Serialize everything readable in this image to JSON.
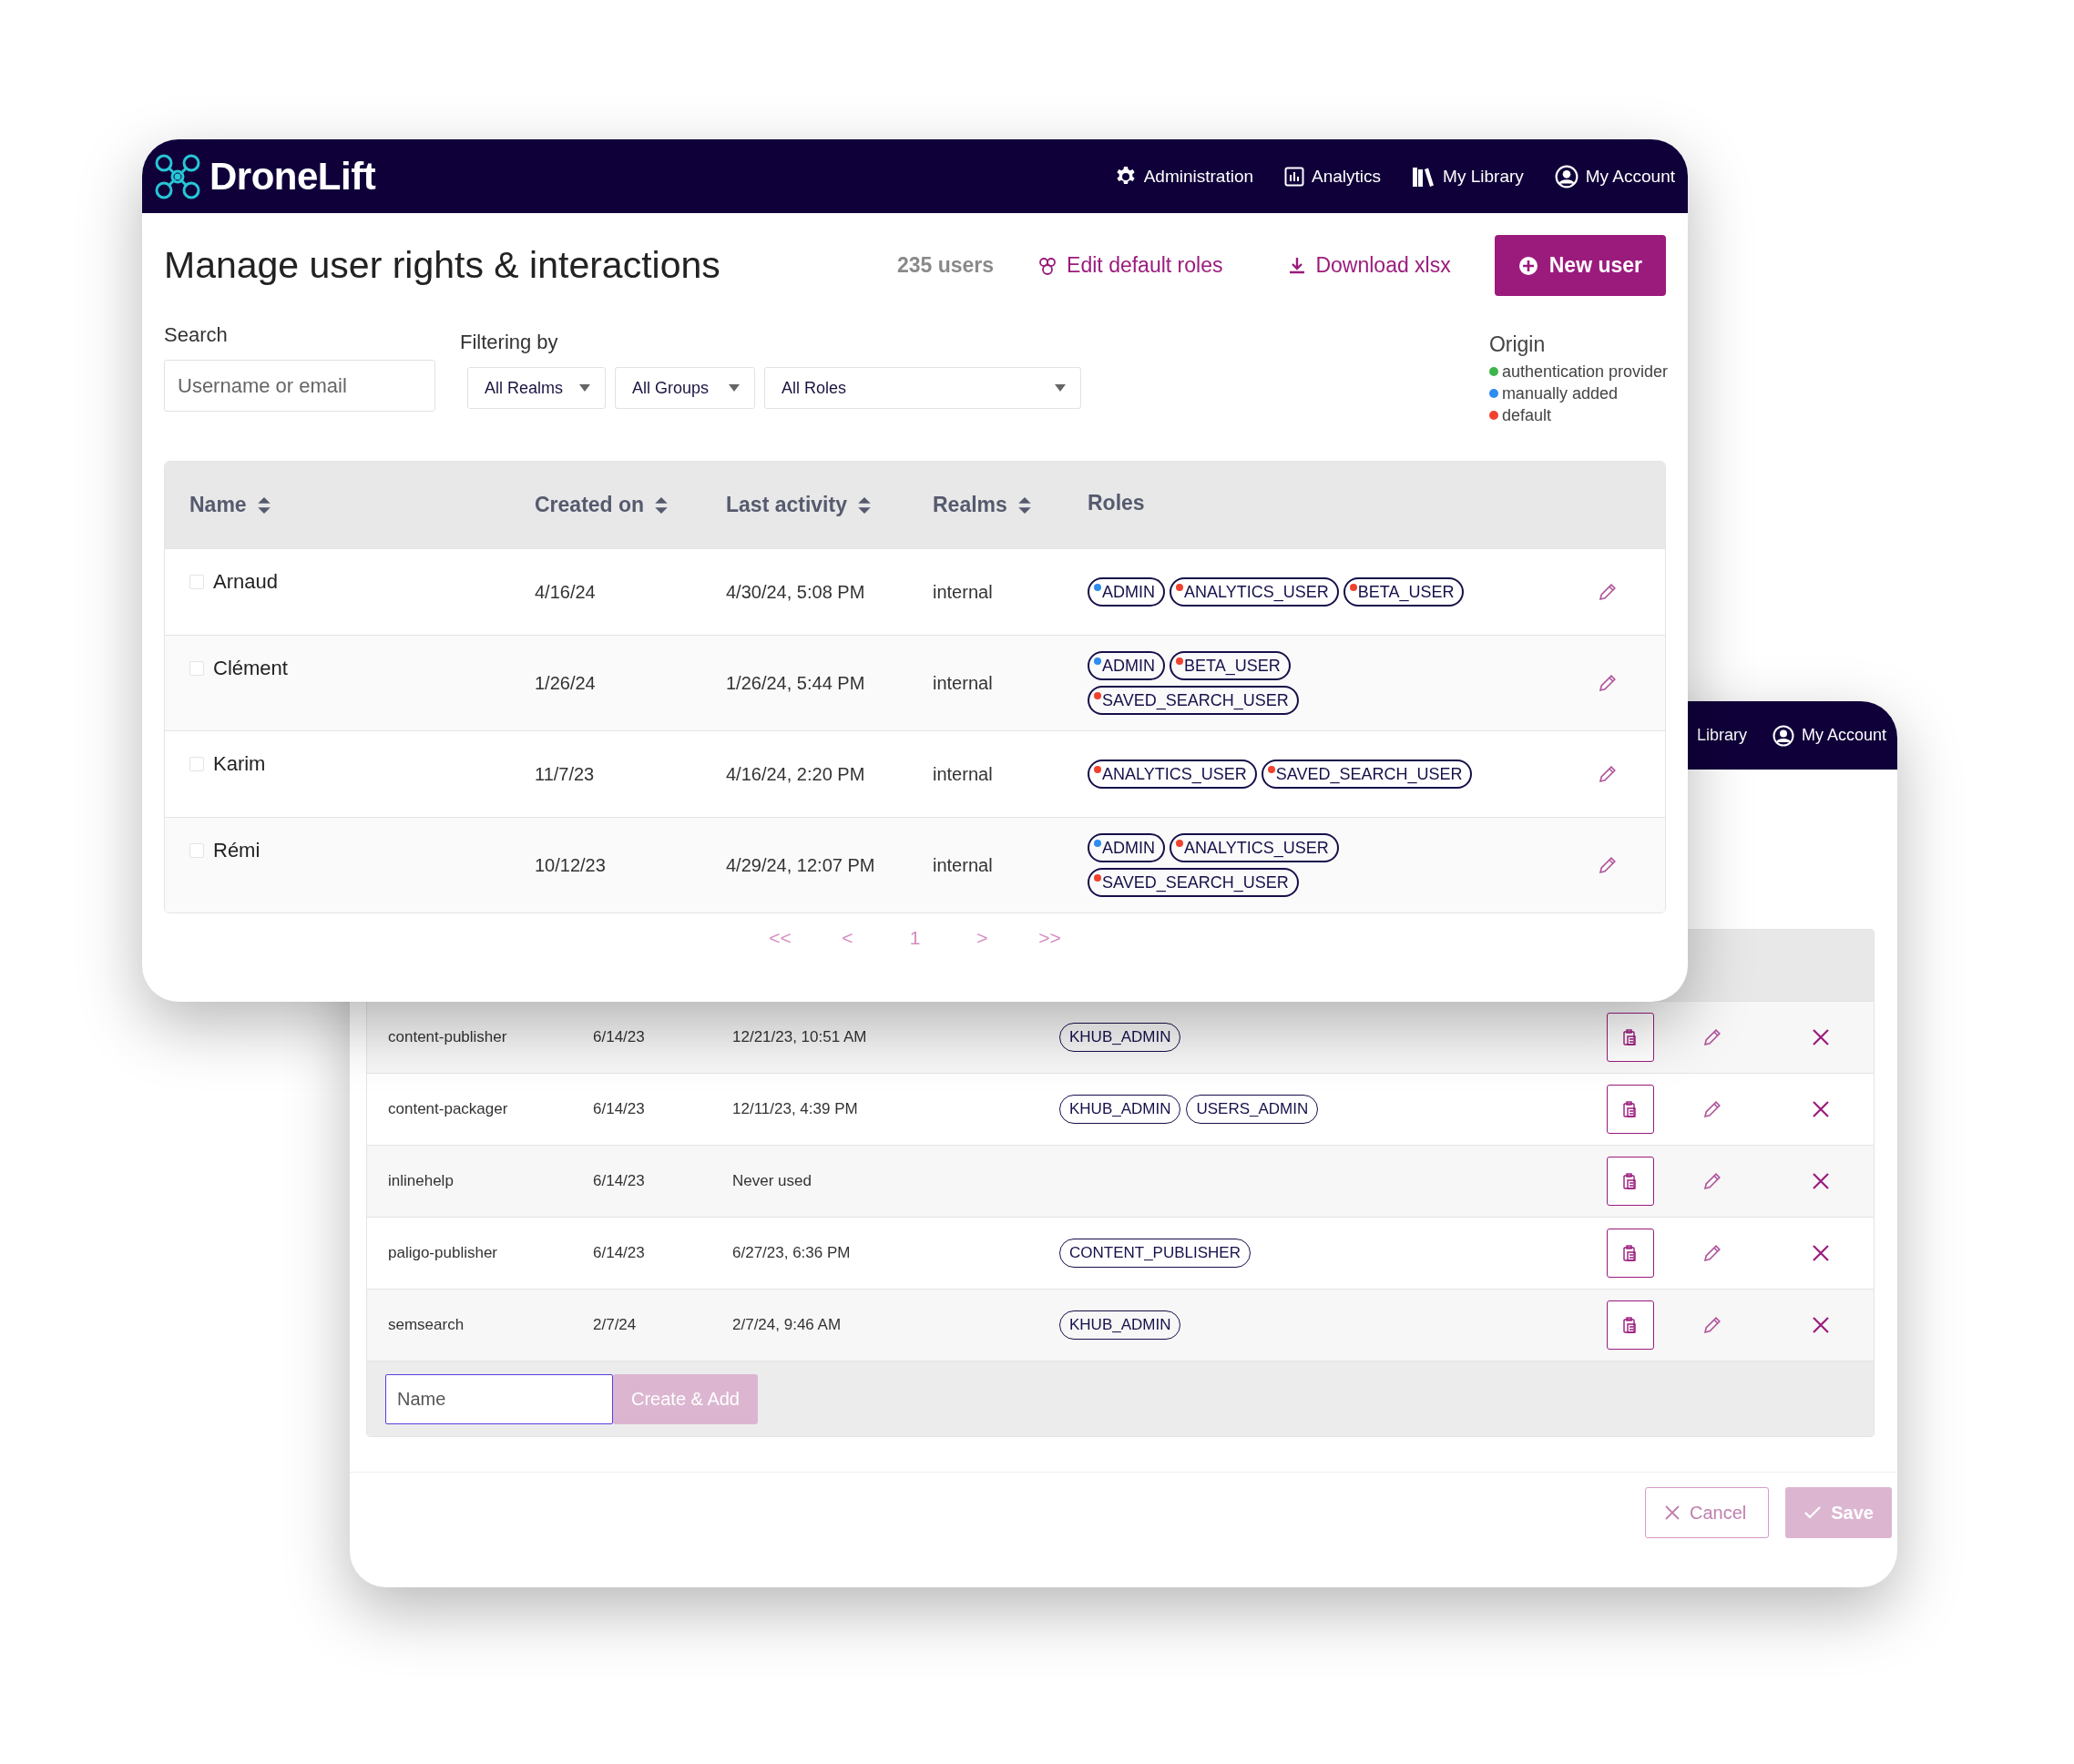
{
  "main_window": {
    "brand": "DroneLift",
    "nav": [
      "Administration",
      "Analytics",
      "My Library",
      "My Account"
    ],
    "title": "Manage user rights & interactions",
    "user_count": "235 users",
    "edit_roles": "Edit default roles",
    "download": "Download xlsx",
    "new_user": "New user",
    "search": {
      "label": "Search",
      "placeholder": "Username or email"
    },
    "filters": {
      "label": "Filtering by",
      "selects": [
        "All Realms",
        "All Groups",
        "All Roles"
      ]
    },
    "origin": {
      "title": "Origin",
      "items": [
        {
          "label": "authentication provider",
          "color": "#3cb54a"
        },
        {
          "label": "manually added",
          "color": "#2f8cf0"
        },
        {
          "label": "default",
          "color": "#f0422e"
        }
      ]
    },
    "table": {
      "columns": [
        {
          "label": "Name",
          "sortable": true
        },
        {
          "label": "Created on",
          "sortable": true
        },
        {
          "label": "Last activity",
          "sortable": true
        },
        {
          "label": "Realms",
          "sortable": true
        },
        {
          "label": "Roles",
          "sortable": false
        }
      ],
      "rows": [
        {
          "checked": false,
          "name": "Arnaud",
          "created": "4/16/24",
          "last_activity": "4/30/24, 5:08 PM",
          "realm": "internal",
          "roles": [
            {
              "label": "ADMIN",
              "color": "#2f8cf0"
            },
            {
              "label": "ANALYTICS_USER",
              "color": "#f0422e"
            },
            {
              "label": "BETA_USER",
              "color": "#f0422e"
            }
          ]
        },
        {
          "checked": false,
          "name": "Clément",
          "created": "1/26/24",
          "last_activity": "1/26/24, 5:44 PM",
          "realm": "internal",
          "roles": [
            {
              "label": "ADMIN",
              "color": "#2f8cf0"
            },
            {
              "label": "BETA_USER",
              "color": "#f0422e"
            },
            {
              "label": "SAVED_SEARCH_USER",
              "color": "#f0422e"
            }
          ]
        },
        {
          "checked": false,
          "name": "Karim",
          "created": "11/7/23",
          "last_activity": "4/16/24, 2:20 PM",
          "realm": "internal",
          "roles": [
            {
              "label": "ANALYTICS_USER",
              "color": "#f0422e"
            },
            {
              "label": "SAVED_SEARCH_USER",
              "color": "#f0422e"
            }
          ]
        },
        {
          "checked": false,
          "name": "Rémi",
          "created": "10/12/23",
          "last_activity": "4/29/24, 12:07 PM",
          "realm": "internal",
          "roles": [
            {
              "label": "ADMIN",
              "color": "#2f8cf0"
            },
            {
              "label": "ANALYTICS_USER",
              "color": "#f0422e"
            },
            {
              "label": "SAVED_SEARCH_USER",
              "color": "#f0422e"
            }
          ]
        }
      ]
    },
    "pagination": [
      "<<",
      "<",
      "1",
      ">",
      ">>"
    ]
  },
  "back_window": {
    "nav": [
      "Library",
      "My Account"
    ],
    "rows": [
      {
        "name": "content-publisher",
        "created": "6/14/23",
        "last_activity": "12/21/23, 10:51 AM",
        "roles": [
          "KHUB_ADMIN"
        ]
      },
      {
        "name": "content-packager",
        "created": "6/14/23",
        "last_activity": "12/11/23, 4:39 PM",
        "roles": [
          "KHUB_ADMIN",
          "USERS_ADMIN"
        ]
      },
      {
        "name": "inlinehelp",
        "created": "6/14/23",
        "last_activity": "Never used",
        "roles": []
      },
      {
        "name": "paligo-publisher",
        "created": "6/14/23",
        "last_activity": "6/27/23, 6:36 PM",
        "roles": [
          "CONTENT_PUBLISHER"
        ]
      },
      {
        "name": "semsearch",
        "created": "2/7/24",
        "last_activity": "2/7/24, 9:46 AM",
        "roles": [
          "KHUB_ADMIN"
        ]
      }
    ],
    "name_field": {
      "placeholder": "Name"
    },
    "create_button": {
      "label": "Create & Add",
      "disabled": true
    },
    "cancel_button": {
      "label": "Cancel",
      "disabled": false
    },
    "save_button": {
      "label": "Save",
      "disabled": true
    }
  }
}
